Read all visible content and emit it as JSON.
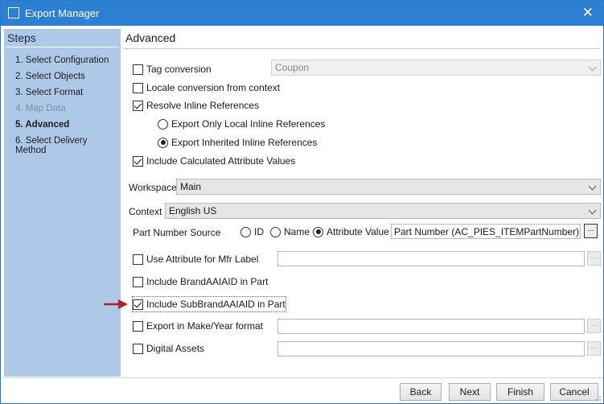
{
  "window": {
    "title": "Export Manager",
    "close_glyph": "✕"
  },
  "steps": {
    "header": "Steps",
    "items": [
      {
        "label": "1. Select Configuration",
        "state": "normal"
      },
      {
        "label": "2. Select Objects",
        "state": "normal"
      },
      {
        "label": "3. Select Format",
        "state": "normal"
      },
      {
        "label": "4. Map Data",
        "state": "disabled"
      },
      {
        "label": "5. Advanced",
        "state": "active"
      },
      {
        "label": "6. Select Delivery Method",
        "state": "normal"
      }
    ]
  },
  "advanced": {
    "title": "Advanced",
    "tag_conversion": {
      "label": "Tag conversion",
      "checked": false,
      "combo_value": "Coupon"
    },
    "locale_conversion": {
      "label": "Locale conversion from context",
      "checked": false
    },
    "resolve_inline": {
      "label": "Resolve Inline References",
      "checked": true
    },
    "export_local": {
      "label": "Export Only Local Inline References",
      "selected": false
    },
    "export_inherited": {
      "label": "Export Inherited Inline References",
      "selected": true
    },
    "include_calculated": {
      "label": "Include Calculated Attribute Values",
      "checked": true
    },
    "workspace": {
      "label": "Workspace",
      "value": "Main"
    },
    "context": {
      "label": "Context",
      "value": "English US"
    },
    "part_number_source": {
      "label": "Part Number Source",
      "options": {
        "id": "ID",
        "name": "Name",
        "attribute_value": "Attribute Value"
      },
      "selected": "attribute_value",
      "value": "Part Number (AC_PIES_ITEMPartNumber)",
      "browse": "..."
    },
    "use_attribute_mfr": {
      "label": "Use Attribute for Mfr Label",
      "checked": false,
      "value": "",
      "browse": "..."
    },
    "include_brand": {
      "label": "Include BrandAAIAID in Part",
      "checked": false
    },
    "include_subbrand": {
      "label": "Include SubBrandAAIAID in Part",
      "checked": true
    },
    "make_year": {
      "label": "Export in Make/Year format",
      "checked": false,
      "value": "",
      "browse": "..."
    },
    "digital_assets": {
      "label": "Digital Assets",
      "checked": false,
      "value": "",
      "browse": "..."
    }
  },
  "buttons": {
    "back": "Back",
    "next": "Next",
    "finish": "Finish",
    "cancel": "Cancel"
  },
  "colors": {
    "titlebar": "#2d7fd3",
    "steps_panel": "#aec9e8",
    "arrow": "#b01f2a"
  }
}
